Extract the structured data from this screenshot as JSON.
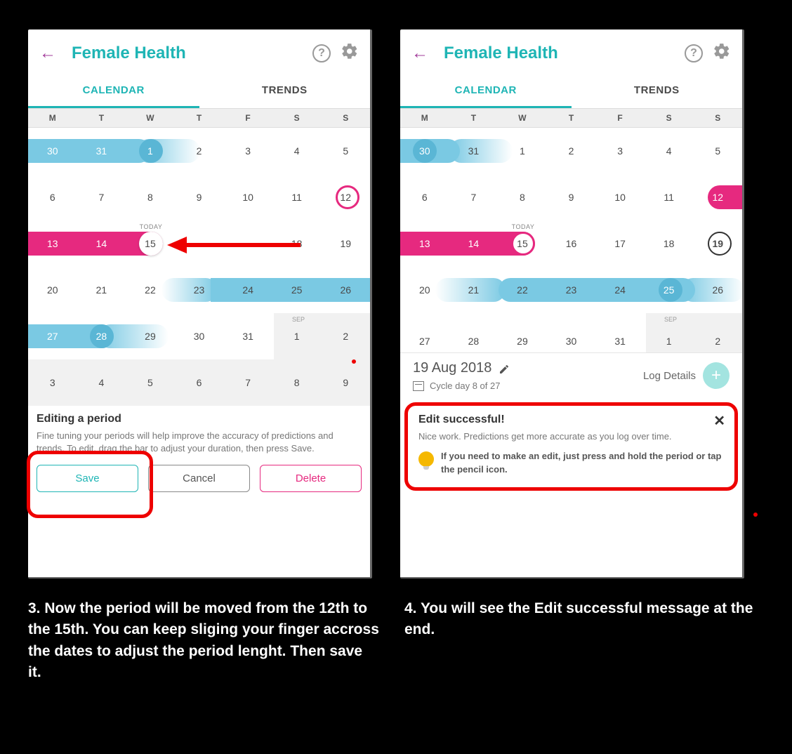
{
  "header": {
    "title": "Female Health"
  },
  "tabs": {
    "calendar": "CALENDAR",
    "trends": "TRENDS"
  },
  "dow": [
    "M",
    "T",
    "W",
    "T",
    "F",
    "S",
    "S"
  ],
  "labels": {
    "today": "TODAY",
    "sep": "SEP"
  },
  "left": {
    "weeks": [
      [
        "30",
        "31",
        "1",
        "2",
        "3",
        "4",
        "5"
      ],
      [
        "6",
        "7",
        "8",
        "9",
        "10",
        "11",
        "12"
      ],
      [
        "13",
        "14",
        "15",
        "",
        "",
        "18",
        "19"
      ],
      [
        "20",
        "21",
        "22",
        "23",
        "24",
        "25",
        "26"
      ],
      [
        "27",
        "28",
        "29",
        "30",
        "31",
        "1",
        "2"
      ],
      [
        "3",
        "4",
        "5",
        "6",
        "7",
        "8",
        "9"
      ]
    ],
    "editing": {
      "title": "Editing a period",
      "body": "Fine tuning your periods will help improve the accuracy of predictions and trends. To edit, drag the bar to adjust your duration, then press Save.",
      "save": "Save",
      "cancel": "Cancel",
      "delete": "Delete"
    }
  },
  "right": {
    "weeks": [
      [
        "30",
        "31",
        "1",
        "2",
        "3",
        "4",
        "5"
      ],
      [
        "6",
        "7",
        "8",
        "9",
        "10",
        "11",
        "12"
      ],
      [
        "13",
        "14",
        "15",
        "16",
        "17",
        "18",
        "19"
      ],
      [
        "20",
        "21",
        "22",
        "23",
        "24",
        "25",
        "26"
      ],
      [
        "27",
        "28",
        "29",
        "30",
        "31",
        "1",
        "2"
      ]
    ],
    "detail": {
      "date": "19 Aug 2018",
      "cycle": "Cycle day 8 of 27",
      "log": "Log Details"
    },
    "success": {
      "title": "Edit successful!",
      "sub": "Nice work. Predictions get more accurate as you log over time.",
      "tip": "If you need to make an edit, just press and hold the period or tap the pencil icon."
    }
  },
  "captions": {
    "c3": "3.  Now the period will be moved from the 12th to the 15th. You can keep sliging your finger accross the dates to adjust the period lenght. Then save it.",
    "c4": "4. You will see the Edit successful message at the end."
  }
}
